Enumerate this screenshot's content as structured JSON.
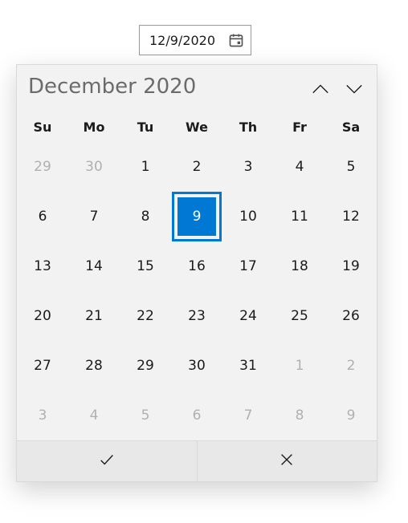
{
  "input": {
    "value": "12/9/2020"
  },
  "calendar": {
    "title": "December 2020",
    "weekdays": [
      "Su",
      "Mo",
      "Tu",
      "We",
      "Th",
      "Fr",
      "Sa"
    ],
    "days": [
      {
        "n": 29,
        "outside": true,
        "selected": false
      },
      {
        "n": 30,
        "outside": true,
        "selected": false
      },
      {
        "n": 1,
        "outside": false,
        "selected": false
      },
      {
        "n": 2,
        "outside": false,
        "selected": false
      },
      {
        "n": 3,
        "outside": false,
        "selected": false
      },
      {
        "n": 4,
        "outside": false,
        "selected": false
      },
      {
        "n": 5,
        "outside": false,
        "selected": false
      },
      {
        "n": 6,
        "outside": false,
        "selected": false
      },
      {
        "n": 7,
        "outside": false,
        "selected": false
      },
      {
        "n": 8,
        "outside": false,
        "selected": false
      },
      {
        "n": 9,
        "outside": false,
        "selected": true
      },
      {
        "n": 10,
        "outside": false,
        "selected": false
      },
      {
        "n": 11,
        "outside": false,
        "selected": false
      },
      {
        "n": 12,
        "outside": false,
        "selected": false
      },
      {
        "n": 13,
        "outside": false,
        "selected": false
      },
      {
        "n": 14,
        "outside": false,
        "selected": false
      },
      {
        "n": 15,
        "outside": false,
        "selected": false
      },
      {
        "n": 16,
        "outside": false,
        "selected": false
      },
      {
        "n": 17,
        "outside": false,
        "selected": false
      },
      {
        "n": 18,
        "outside": false,
        "selected": false
      },
      {
        "n": 19,
        "outside": false,
        "selected": false
      },
      {
        "n": 20,
        "outside": false,
        "selected": false
      },
      {
        "n": 21,
        "outside": false,
        "selected": false
      },
      {
        "n": 22,
        "outside": false,
        "selected": false
      },
      {
        "n": 23,
        "outside": false,
        "selected": false
      },
      {
        "n": 24,
        "outside": false,
        "selected": false
      },
      {
        "n": 25,
        "outside": false,
        "selected": false
      },
      {
        "n": 26,
        "outside": false,
        "selected": false
      },
      {
        "n": 27,
        "outside": false,
        "selected": false
      },
      {
        "n": 28,
        "outside": false,
        "selected": false
      },
      {
        "n": 29,
        "outside": false,
        "selected": false
      },
      {
        "n": 30,
        "outside": false,
        "selected": false
      },
      {
        "n": 31,
        "outside": false,
        "selected": false
      },
      {
        "n": 1,
        "outside": true,
        "selected": false
      },
      {
        "n": 2,
        "outside": true,
        "selected": false
      },
      {
        "n": 3,
        "outside": true,
        "selected": false
      },
      {
        "n": 4,
        "outside": true,
        "selected": false
      },
      {
        "n": 5,
        "outside": true,
        "selected": false
      },
      {
        "n": 6,
        "outside": true,
        "selected": false
      },
      {
        "n": 7,
        "outside": true,
        "selected": false
      },
      {
        "n": 8,
        "outside": true,
        "selected": false
      },
      {
        "n": 9,
        "outside": true,
        "selected": false
      }
    ]
  },
  "selection_color": "#0078d4"
}
